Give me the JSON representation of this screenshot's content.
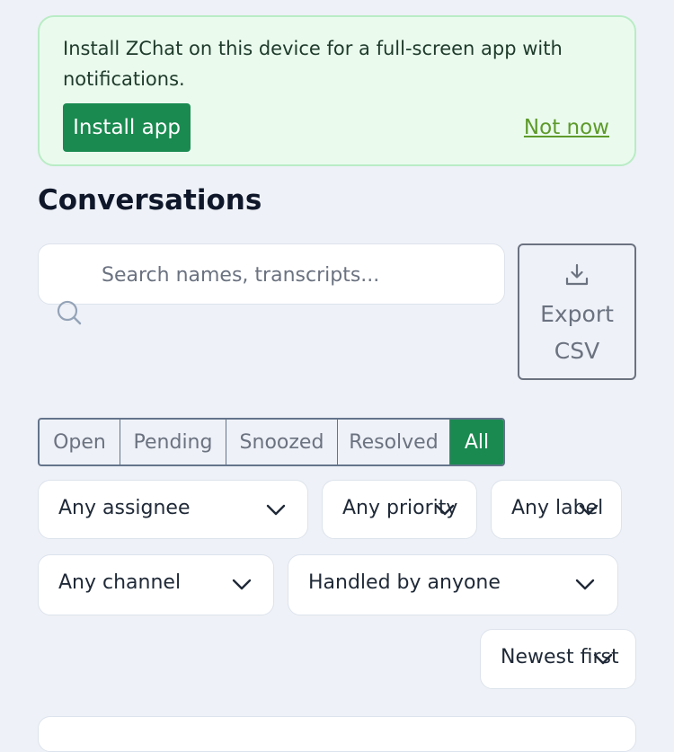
{
  "install_banner": {
    "message": "Install ZChat on this device for a full-screen app with notifications.",
    "install_label": "Install app",
    "dismiss_label": "Not now"
  },
  "page": {
    "title": "Conversations"
  },
  "search": {
    "placeholder": "Search names, transcripts..."
  },
  "export": {
    "label": "Export\nCSV"
  },
  "status_tabs": [
    {
      "label": "Open",
      "active": false
    },
    {
      "label": "Pending",
      "active": false
    },
    {
      "label": "Snoozed",
      "active": false
    },
    {
      "label": "Resolved",
      "active": false
    },
    {
      "label": "All",
      "active": true
    }
  ],
  "filters": {
    "assignee": "Any assignee",
    "priority": "Any priority",
    "label": "Any label",
    "channel": "Any channel",
    "handled_by": "Handled by anyone",
    "sort": "Newest first"
  },
  "colors": {
    "accent": "#1a8a50",
    "banner_bg": "#eafbee",
    "link": "#5e9a2b",
    "page_bg": "#eef1f7"
  }
}
